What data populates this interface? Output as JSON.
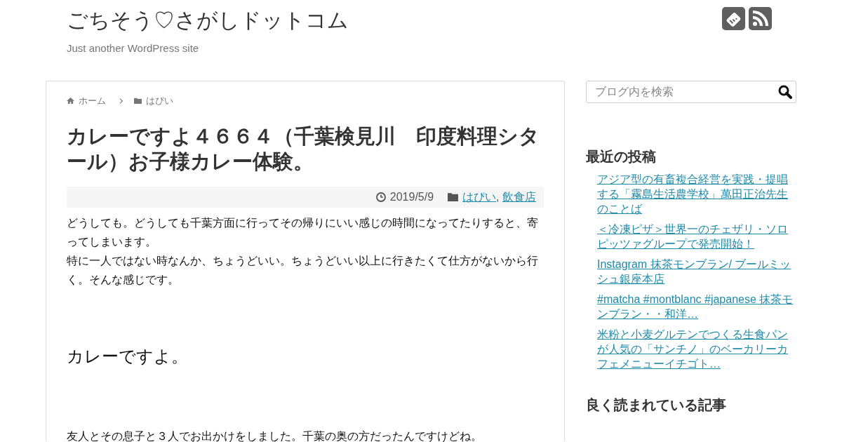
{
  "header": {
    "site_title": "ごちそう♡さがしドットコム",
    "tagline": "Just another WordPress site"
  },
  "breadcrumb": [
    {
      "label": "ホーム",
      "kind": "home"
    },
    {
      "label": "はぴい",
      "kind": "category"
    }
  ],
  "article": {
    "title": "カレーですよ４６６４（千葉検見川　印度料理シタール）お子様カレー体験。",
    "date": "2019/5/9",
    "categories": [
      "はぴい",
      "飲食店"
    ],
    "category_separator": ",",
    "blocks": [
      {
        "kind": "paragraph",
        "text": "どうしても。どうしても千葉方面に行ってその帰りにいい感じの時間になってたりすると、寄ってしまいます。"
      },
      {
        "kind": "paragraph",
        "text": "特に一人ではない時なんか、ちょうどいい。ちょうどいい以上に行きたくて仕方がないから行く。そんな感じです。"
      },
      {
        "kind": "heading",
        "text": "カレーですよ。"
      },
      {
        "kind": "paragraph",
        "text": "友人とその息子と３人でお出かけをしました。千葉の奥の方だったんですけどね。"
      }
    ]
  },
  "sidebar": {
    "search": {
      "placeholder": "ブログ内を検索"
    },
    "recent_title": "最近の投稿",
    "recent_posts": [
      "アジア型の有畜複合経営を実践・提唱する「霧島生活農学校」萬田正治先生のことば",
      "＜冷凍ピザ＞世界一のチェザリ・ソロピッツァグループで発売開始！",
      "Instagram 抹茶モンブラン/ ブールミッシュ銀座本店",
      "#matcha #montblanc #japanese 抹茶モンブラン・・和洋…",
      "米粉と小麦グルテンでつくる生食パンが人気の「サンチノ」のベーカリーカフェメニューイチゴト…"
    ],
    "popular_title": "良く読まれている記事"
  }
}
